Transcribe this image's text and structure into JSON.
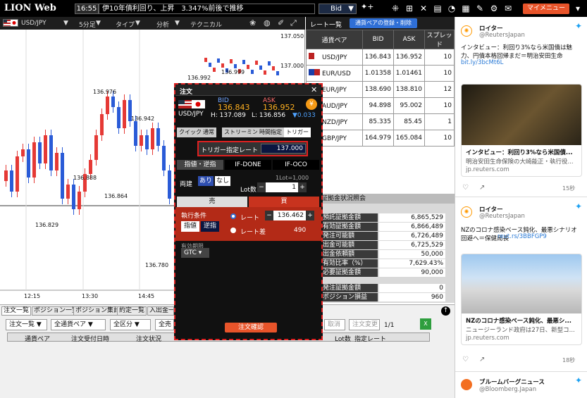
{
  "topbar": {
    "logo": "LION Web",
    "time": "16:55",
    "ticker": "伊10年債利回り、上昇　3.347%前後で推移",
    "bid_selector": "Bid",
    "mypage": "マイメニュー"
  },
  "chartbar": {
    "pair": "USD/JPY",
    "interval": "5分足",
    "type": "タイプ",
    "analysis": "分析",
    "technical": "テクニカル"
  },
  "chart": {
    "y_ticks": [
      "137.050",
      "137.000"
    ],
    "x_ticks": [
      "12:15",
      "13:30",
      "14:45"
    ],
    "price_labels": [
      "136.992",
      "136.999",
      "136.976",
      "136.942",
      "136.888",
      "136.864",
      "136.829",
      "136.780"
    ]
  },
  "ratepanel": {
    "tab_list": "レート一覧",
    "tab_register": "通貨ペアの登録・削除",
    "columns": [
      "通貨ペア",
      "BID",
      "ASK",
      "スプレッド"
    ],
    "rows": [
      {
        "pair": "USD/JPY",
        "bid": "136.843",
        "ask": "136.952",
        "spread": "10"
      },
      {
        "pair": "EUR/USD",
        "bid": "1.01358",
        "ask": "1.01461",
        "spread": "10"
      },
      {
        "pair": "EUR/JPY",
        "bid": "138.690",
        "ask": "138.810",
        "spread": "12"
      },
      {
        "pair": "AUD/JPY",
        "bid": "94.898",
        "ask": "95.002",
        "spread": "10"
      },
      {
        "pair": "NZD/JPY",
        "bid": "85.335",
        "ask": "85.45",
        "spread": "1"
      },
      {
        "pair": "GBP/JPY",
        "bid": "164.979",
        "ask": "165.084",
        "spread": "10"
      }
    ]
  },
  "account": {
    "header": "証拠金状況照会",
    "rows": [
      {
        "k": "預託証拠金額",
        "v": "6,865,529"
      },
      {
        "k": "有効証拠金額",
        "v": "6,866,489"
      },
      {
        "k": "発注可能額",
        "v": "6,726,489"
      },
      {
        "k": "出金可能額",
        "v": "6,725,529"
      },
      {
        "k": "出金依頼額",
        "v": "50,000"
      },
      {
        "k": "有効比率（%）",
        "v": "7,629.43%"
      },
      {
        "k": "必要証拠金額",
        "v": "90,000"
      },
      {
        "k": "発注証拠金額",
        "v": "0"
      },
      {
        "k": "ポジション損益",
        "v": "960"
      }
    ]
  },
  "bottom": {
    "tabs": [
      "注文一覧",
      "ポジション一覧",
      "ポジション集計",
      "約定一覧",
      "入出金一覧"
    ],
    "filter_list": "注文一覧",
    "filter_pair": "全通貨ペア",
    "filter_kind": "全区分",
    "filter_trade": "全売買",
    "cancel": "取消",
    "change": "注文変更",
    "page": "1/1",
    "columns": [
      "通貨ペア",
      "注文受付日時",
      "注文状況",
      "Lot数",
      "指定レート"
    ]
  },
  "order": {
    "title": "注文",
    "pair": "USD/JPY",
    "bid_label": "BID",
    "ask_label": "ASK",
    "bid": "136.843",
    "ask": "136.952",
    "high": "H: 137.089",
    "low": "L: 136.856",
    "change": "▼0.033",
    "tabs": [
      "クイック",
      "通常",
      "ストリーミング",
      "時間指定",
      "トリガー"
    ],
    "trigger_label": "トリガー指定レート",
    "trigger_value": "137.000",
    "subtabs": [
      "指値・逆指",
      "IF-DONE",
      "IF-OCO"
    ],
    "both_label": "両建",
    "both_on": "あり",
    "both_off": "なし",
    "lot_hint": "1Lot=1,000",
    "lot_label": "Lot数",
    "lot_value": "1",
    "sell": "売",
    "buy": "買",
    "exec_label": "執行条件",
    "limit": "指値",
    "stop": "逆指",
    "rate_label": "レート",
    "rate_value": "136.462",
    "diff_label": "レート差",
    "diff_value": "490",
    "expiry_label": "有効期限",
    "expiry_value": "GTC",
    "confirm": "注文確認"
  },
  "twitter": {
    "t1_name": "ロイター",
    "t1_handle": "@ReutersJapan",
    "t1_text": "インタビュー：利回り3%なら米国債は魅力、円債本格回帰まだ＝明治安田生命",
    "t1_link": "bit.ly/3bcMt6L",
    "t1_card_title": "インタビュー：利回り3%なら米国債...",
    "t1_card_desc": "明治安田生命保険の大崎能正・執行役...",
    "t1_card_domain": "jp.reuters.com",
    "t1_likes": "15秒",
    "t2_name": "ロイター",
    "t2_handle": "@ReutersJapan",
    "t2_text": "NZのコロナ感染ベース鈍化、最悪シナリオ回避へ＝保健局長",
    "t2_link": "reut.rs/3BBFGP9",
    "t2_card_title": "NZのコロナ感染ベース鈍化、最悪シ...",
    "t2_card_desc": "ニュージーランド政府は27日、新型コ...",
    "t2_card_domain": "jp.reuters.com",
    "t2_likes": "18秒",
    "t3_name": "ブルームバーグニュース",
    "t3_handle": "@Bloomberg.Japan"
  },
  "colors": {
    "accent": "#e8542a",
    "bull": "#e53935",
    "bear": "#2a5bd7"
  }
}
